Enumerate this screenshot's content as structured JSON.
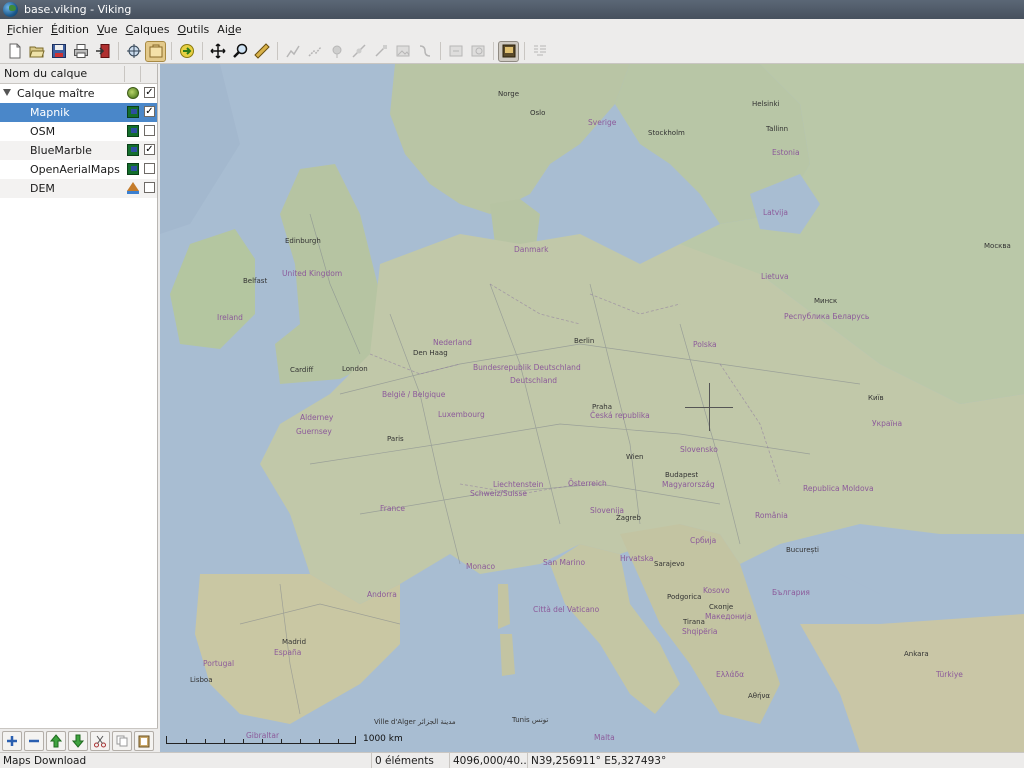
{
  "window": {
    "title": "base.viking - Viking"
  },
  "menubar": {
    "items": [
      {
        "mnemonic": "F",
        "rest": "ichier"
      },
      {
        "mnemonic": "É",
        "rest": "dition"
      },
      {
        "mnemonic": "V",
        "rest": "ue"
      },
      {
        "mnemonic": "C",
        "rest": "alques"
      },
      {
        "mnemonic": "O",
        "rest": "utils"
      },
      {
        "prefix": "Ai",
        "mnemonic": "d",
        "rest": "e"
      }
    ]
  },
  "toolbar": {
    "buttons": [
      "new-file-icon",
      "open-file-icon",
      "save-icon",
      "print-icon",
      "exit-icon",
      "zoom-pan-icon",
      "edit-layer-icon",
      "go-forward-icon",
      "pan-icon",
      "zoom-icon",
      "ruler-icon",
      "create-track-icon",
      "create-route-icon",
      "create-waypoint-icon",
      "edit-trackpoint-icon",
      "edit-waypoint-icon",
      "show-picture-icon",
      "splitter-icon",
      "georef-move-icon",
      "georef-zoom-icon",
      "maps-download-icon",
      "dem-download-icon"
    ]
  },
  "layers": {
    "header": "Nom du calque",
    "root": {
      "name": "Calque maître",
      "checked": true,
      "icon": "aggregate-globe-icon"
    },
    "items": [
      {
        "name": "Mapnik",
        "checked": true,
        "selected": true,
        "icon": "map-layer-icon"
      },
      {
        "name": "OSM",
        "checked": false,
        "selected": false,
        "icon": "map-layer-icon"
      },
      {
        "name": "BlueMarble",
        "checked": true,
        "selected": false,
        "icon": "map-layer-icon"
      },
      {
        "name": "OpenAerialMaps",
        "checked": false,
        "selected": false,
        "icon": "map-layer-icon"
      },
      {
        "name": "DEM",
        "checked": false,
        "selected": false,
        "icon": "dem-layer-icon"
      }
    ],
    "buttons": [
      "add-layer-icon",
      "remove-layer-icon",
      "move-up-icon",
      "move-down-icon",
      "cut-icon",
      "copy-icon",
      "paste-icon"
    ]
  },
  "map": {
    "scale_label": "1000 km",
    "labels": {
      "norge": "Norge",
      "oslo": "Oslo",
      "sverige": "Sverige",
      "stockholm": "Stockholm",
      "helsinki": "Helsinki",
      "tallinn": "Tallinn",
      "eesti": "Estonia",
      "latvija": "Latvija",
      "lietuva": "Lietuva",
      "moskva": "Москва",
      "minsk": "Минск",
      "belarus": "Республика Беларусь",
      "danmark": "Danmark",
      "edinburgh": "Edinburgh",
      "belfast": "Belfast",
      "uk": "United Kingdom",
      "ireland": "Ireland",
      "cardiff": "Cardiff",
      "london": "London",
      "nederland": "Nederland",
      "denhaag": "Den Haag",
      "berlin": "Berlin",
      "bundesrepublik": "Bundesrepublik Deutschland",
      "deutschland": "Deutschland",
      "polska": "Polska",
      "belgie": "België / Belgique",
      "luxembourg": "Luxembourg",
      "paris": "Paris",
      "praha": "Praha",
      "cesko": "Česká republika",
      "slovensko": "Slovensko",
      "ukraina": "Україна",
      "kyiv": "Київ",
      "wien": "Wien",
      "budapest": "Budapest",
      "magyar": "Magyarország",
      "moldova": "Republica Moldova",
      "liechtenstein": "Liechtenstein",
      "osterreich": "Österreich",
      "schweiz": "Schweiz/Suisse",
      "france": "France",
      "slovenija": "Slovenija",
      "zagreb": "Zagreb",
      "romania": "România",
      "srbija": "Србија",
      "bucuresti": "București",
      "hrvatska": "Hrvatska",
      "sarajevo": "Sarajevo",
      "monaco": "Monaco",
      "sanmarino": "San Marino",
      "kosovo": "Kosovo",
      "bulgaria": "България",
      "andorra": "Andorra",
      "podgorica": "Podgorica",
      "skopje": "Скопје",
      "makedonija": "Македонија",
      "cittavaticano": "Città del Vaticano",
      "tirana": "Tirana",
      "albania": "Shqipëria",
      "madrid": "Madrid",
      "espana": "España",
      "portugal": "Portugal",
      "lisboa": "Lisboa",
      "ellada": "Ελλάδα",
      "athina": "Αθήνα",
      "ankara": "Ankara",
      "turkiye": "Türkiye",
      "villedalger": "Ville d'Alger مدينة الجزائر",
      "tunis": "Tunis تونس",
      "malta": "Malta",
      "gibraltar": "Gibraltar",
      "guernsey": "Guernsey",
      "alderney": "Alderney"
    }
  },
  "status": {
    "message": "Maps Download",
    "items_count": "0 éléments",
    "zoom": "4096,000/40...",
    "coords": "N39,256911° E5,327493°"
  }
}
